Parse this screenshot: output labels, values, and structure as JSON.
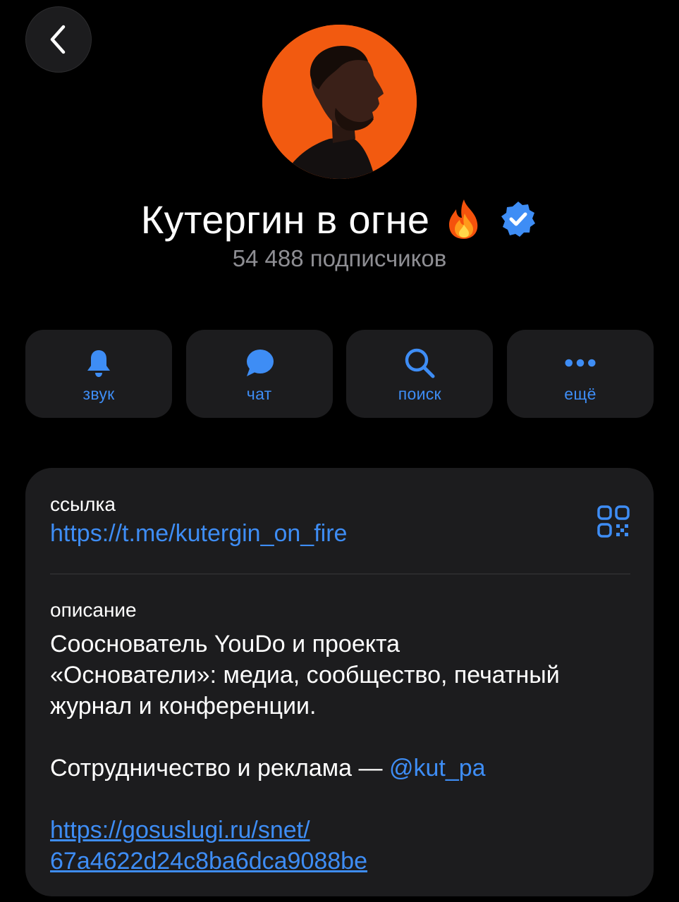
{
  "nav": {
    "back_icon": "chevron-left-icon"
  },
  "channel": {
    "title": "Кутергин в огне",
    "emoji": "🔥",
    "verified_icon": "verified-badge-icon",
    "subscribers": "54 488 подписчиков"
  },
  "actions": [
    {
      "label": "звук",
      "icon": "bell-icon"
    },
    {
      "label": "чат",
      "icon": "chat-bubble-icon"
    },
    {
      "label": "поиск",
      "icon": "search-icon"
    },
    {
      "label": "ещё",
      "icon": "more-dots-icon"
    }
  ],
  "info": {
    "link_label": "ссылка",
    "link_value": "https://t.me/kutergin_on_fire",
    "qr_icon": "qr-code-icon",
    "description_label": "описание",
    "description_lines": [
      "Сооснователь YouDo и проекта",
      "«Основатели»: медиа, сообщество, печатный",
      "журнал и конференции."
    ],
    "contact_text": "Сотрудничество и реклама — ",
    "contact_mention": "@kut_pa",
    "url_lines": [
      "https://gosuslugi.ru/snet/",
      "67a4622d24c8ba6dca9088be"
    ]
  },
  "colors": {
    "background": "#000000",
    "card": "#1c1c1e",
    "accent": "#3e8df5",
    "secondary_text": "#8e8e93",
    "avatar_bg": "#f25a10"
  }
}
